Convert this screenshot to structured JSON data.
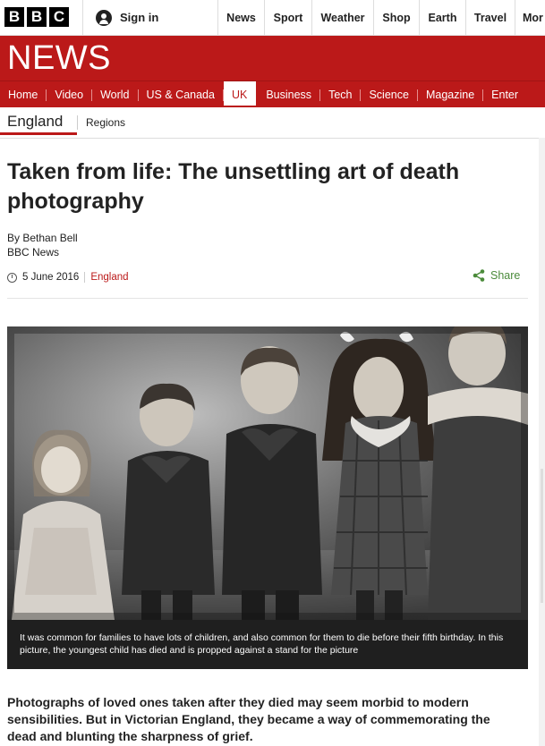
{
  "brand": {
    "letters": [
      "B",
      "B",
      "C"
    ]
  },
  "account": {
    "signin_label": "Sign in"
  },
  "topnav": [
    "News",
    "Sport",
    "Weather",
    "Shop",
    "Earth",
    "Travel",
    "Mor"
  ],
  "section_logo": "NEWS",
  "mainnav": [
    "Home",
    "Video",
    "World",
    "US & Canada",
    "UK",
    "Business",
    "Tech",
    "Science",
    "Magazine",
    "Enter"
  ],
  "mainnav_active": "UK",
  "subnav": {
    "current": "England",
    "other": "Regions"
  },
  "article": {
    "title": "Taken from life: The unsettling art of death photography",
    "author": "By Bethan Bell",
    "source": "BBC News",
    "date": "5 June 2016",
    "topic": "England",
    "share_label": "Share",
    "caption": "It was common for families to have lots of children, and also common for them to die before their fifth birthday. In this picture, the youngest child has died and is propped against a stand for the picture",
    "lead": "Photographs of loved ones taken after they died may seem morbid to modern sensibilities. But in Victorian England, they became a way of commemorating the dead and blunting the sharpness of grief."
  },
  "colors": {
    "brand_red": "#bb1919",
    "share_green": "#4b8b3b",
    "caption_bg": "#1f1f1f"
  }
}
